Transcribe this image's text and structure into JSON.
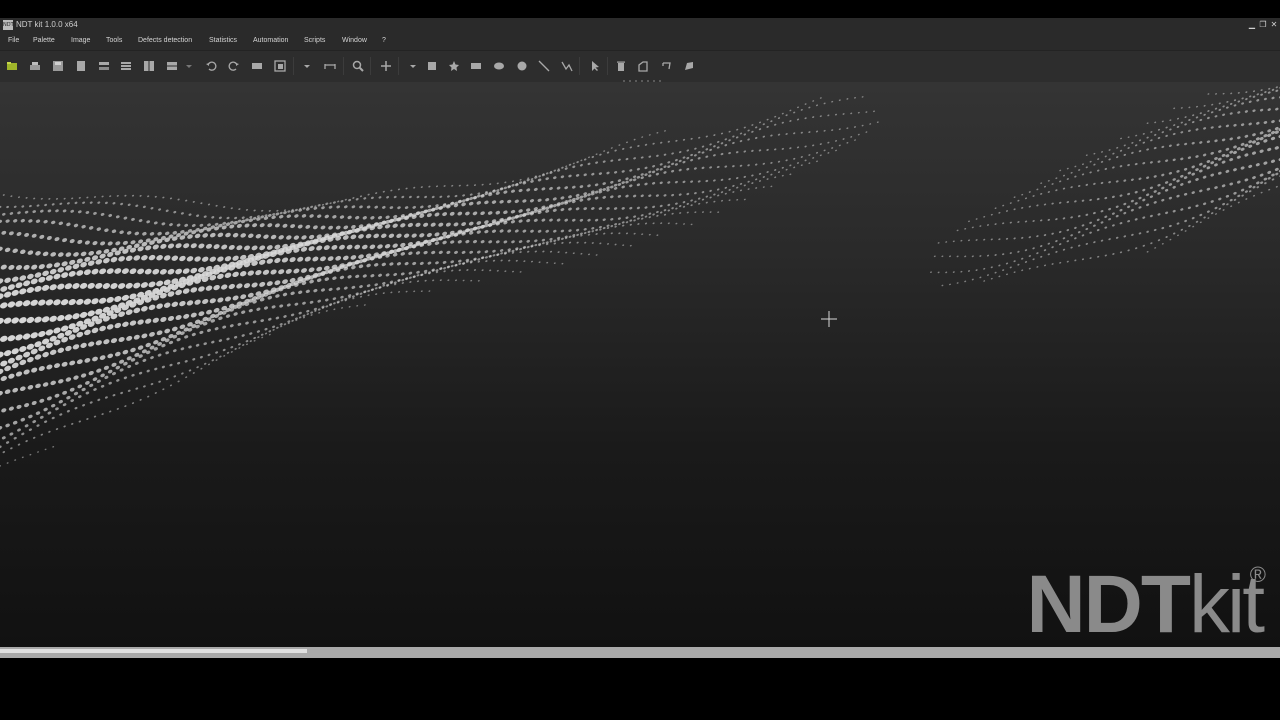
{
  "window": {
    "title": "NDT kit 1.0.0 x64",
    "icon_label": "NDT",
    "controls": [
      "minimize-icon",
      "restore-icon",
      "close-icon"
    ]
  },
  "menu": [
    "File",
    "Palette",
    "Image",
    "Tools",
    "Defects detection",
    "Statistics",
    "Automation",
    "Scripts",
    "Window",
    "?"
  ],
  "toolbar": {
    "tools": [
      "open-folder-icon",
      "print-icon",
      "save-icon",
      "page-icon",
      "layout-h-icon",
      "layout-v-icon",
      "layout-grid-icon",
      "layout-split-icon",
      "dropdown-icon",
      "undo-icon",
      "redo-icon",
      "image-icon",
      "export-icon",
      "dropdown-icon",
      "measure-icon",
      "zoom-icon",
      "crosshair-icon",
      "dropdown-icon",
      "rectangle-select-icon",
      "star-select-icon",
      "rectangle-icon",
      "ellipse-icon",
      "circle-icon",
      "line-icon",
      "polyline-icon",
      "pointer-icon",
      "delete-icon",
      "copy-shape-icon",
      "mirror-shape-icon",
      "fill-shape-icon"
    ]
  },
  "logo": {
    "bold_text": "NDT",
    "light_text": "kit",
    "mark": "®",
    "color": "#8a8a8a"
  },
  "statusbar": {
    "progress": 0.24
  },
  "colors": {
    "chrome": "#2a2a2a",
    "toolbar": "#2d2d2d",
    "dots": "#d8d8d8",
    "statusbar": "#a9a9a9"
  }
}
